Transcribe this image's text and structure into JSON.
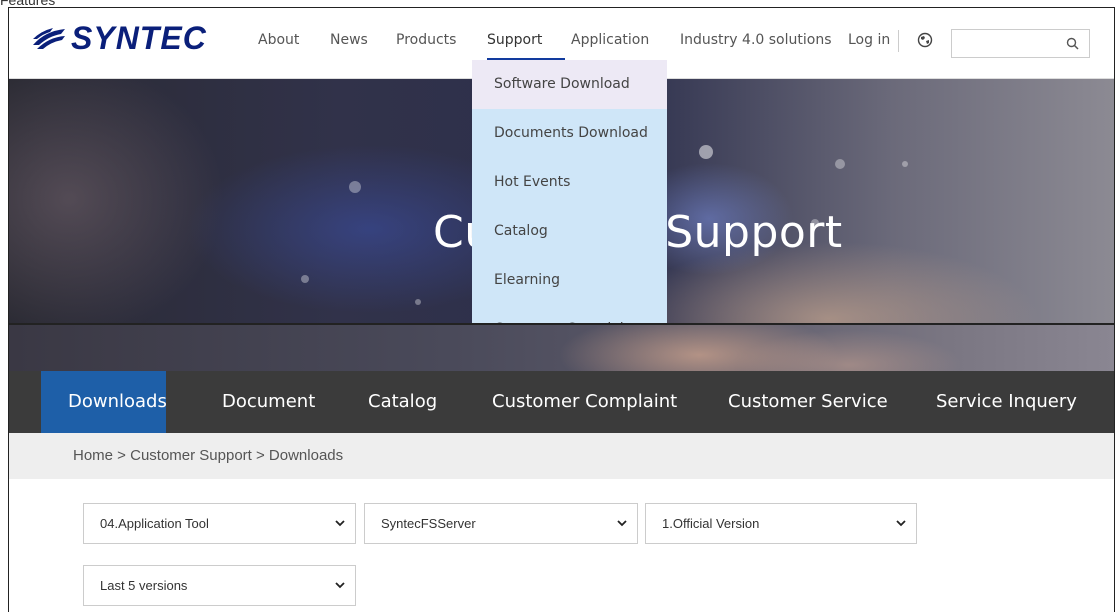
{
  "header": {
    "cropped_text": "Features",
    "logo_text": "SYNTEC",
    "nav": [
      "About",
      "News",
      "Products",
      "Support",
      "Application",
      "Industry 4.0 solutions"
    ],
    "login": "Log in",
    "search_placeholder": ""
  },
  "support_menu": {
    "items": [
      "Software Download",
      "Documents Download",
      "Hot Events",
      "Catalog",
      "Elearning",
      "Customer Complaint"
    ]
  },
  "hero": {
    "title": "Customer Support"
  },
  "tabs": [
    "Downloads",
    "Document",
    "Catalog",
    "Customer Complaint",
    "Customer Service",
    "Service Inquery"
  ],
  "breadcrumb": "Home > Customer Support > Downloads",
  "filters": {
    "category": "04.Application Tool",
    "product": "SyntecFSServer",
    "version_type": "1.Official Version",
    "range": "Last 5 versions"
  },
  "colors": {
    "brand": "#0a1f7a",
    "active_tab": "#1e5fa8",
    "tab_bar": "#3b3b3b",
    "dropdown_bg": "#cfe6f8"
  }
}
